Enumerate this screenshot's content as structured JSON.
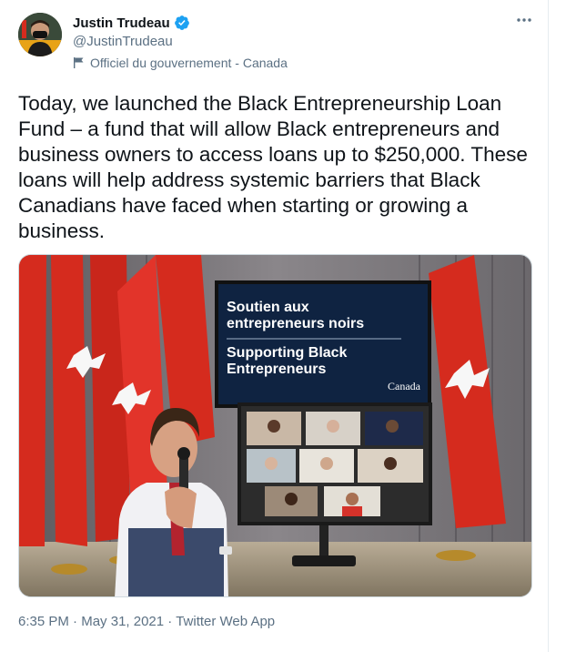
{
  "author": {
    "display_name": "Justin Trudeau",
    "handle": "@JustinTrudeau",
    "verified": true,
    "avatar_icon": "person-with-mask-avatar",
    "label": "Officiel du gouvernement - Canada",
    "label_icon": "flag-icon"
  },
  "more_icon": "more-horizontal-icon",
  "tweet": {
    "text": "Today, we launched the Black Entrepreneurship Loan Fund – a fund that will allow Black entrepreneurs and business owners to access loans up to $250,000. These loans will help address systemic barriers that Black Canadians have faced when starting or growing a business."
  },
  "media": {
    "screen_title_fr": [
      "Soutien aux",
      "entrepreneurs noirs"
    ],
    "screen_title_en": [
      "Supporting Black",
      "Entrepreneurs"
    ],
    "screen_brand": "Canada"
  },
  "footer": {
    "time": "6:35 PM",
    "sep1": " · ",
    "date": "May 31, 2021",
    "sep2": " · ",
    "source": "Twitter Web App"
  },
  "colors": {
    "text_primary": "#0f1419",
    "text_secondary": "#5b7083",
    "verified_blue": "#1da1f2",
    "flag_red": "#d52b1e",
    "screen_navy": "#0f2341"
  }
}
